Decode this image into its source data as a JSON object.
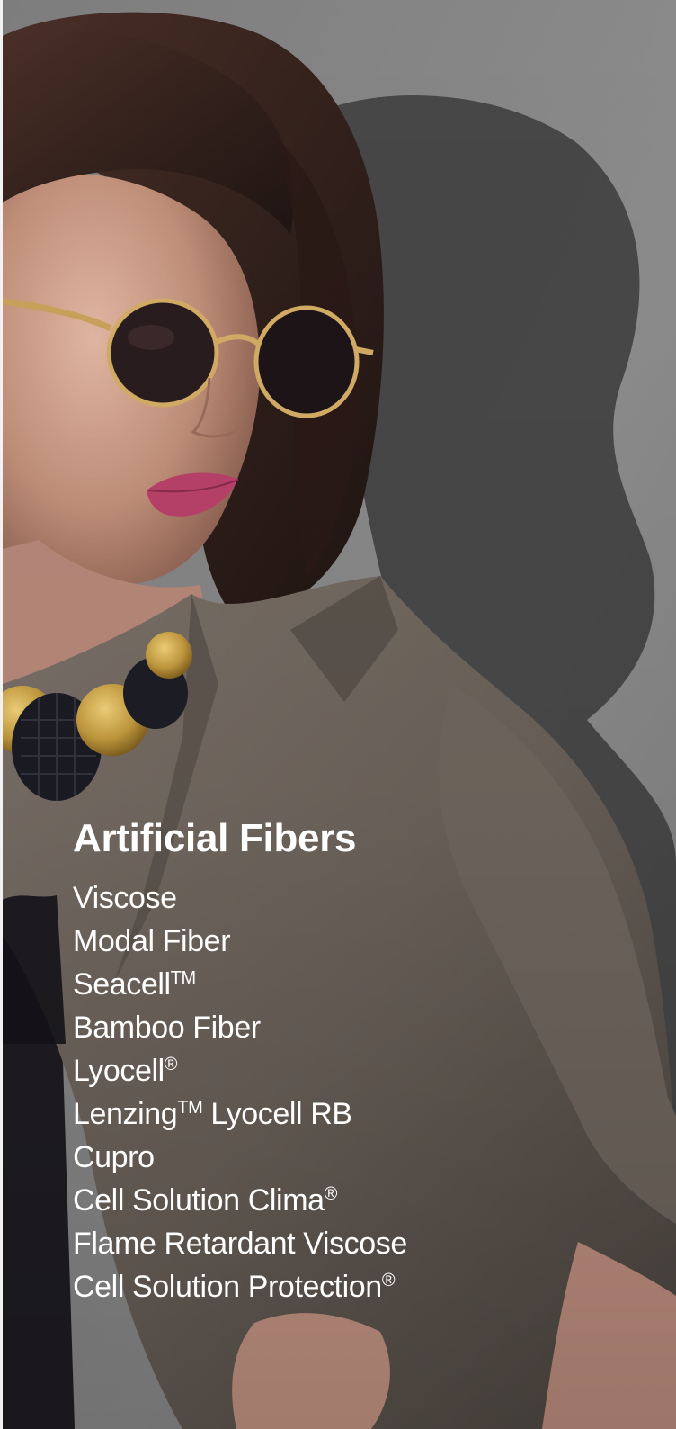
{
  "section": {
    "title": "Artificial Fibers",
    "background_description": "fashion-photo"
  },
  "fibers": [
    {
      "name": "Viscose",
      "mark": ""
    },
    {
      "name": "Modal Fiber",
      "mark": ""
    },
    {
      "name": "Seacell",
      "mark": "TM"
    },
    {
      "name": "Bamboo Fiber",
      "mark": ""
    },
    {
      "name": "Lyocell",
      "mark": "®"
    },
    {
      "name": "Lenzing",
      "mark": "TM",
      "suffix": " Lyocell RB"
    },
    {
      "name": "Cupro",
      "mark": ""
    },
    {
      "name": "Cell Solution Clima",
      "mark": "®"
    },
    {
      "name": "Flame Retardant Viscose",
      "mark": ""
    },
    {
      "name": "Cell Solution Protection",
      "mark": "®"
    }
  ],
  "colors": {
    "text": "#ffffff",
    "backdrop": "#8a8a8a",
    "shadow": "#3a3a3a",
    "coat": "#6e655c",
    "hair": "#3b2620",
    "skin": "#c99a86",
    "lips": "#b53e61"
  }
}
